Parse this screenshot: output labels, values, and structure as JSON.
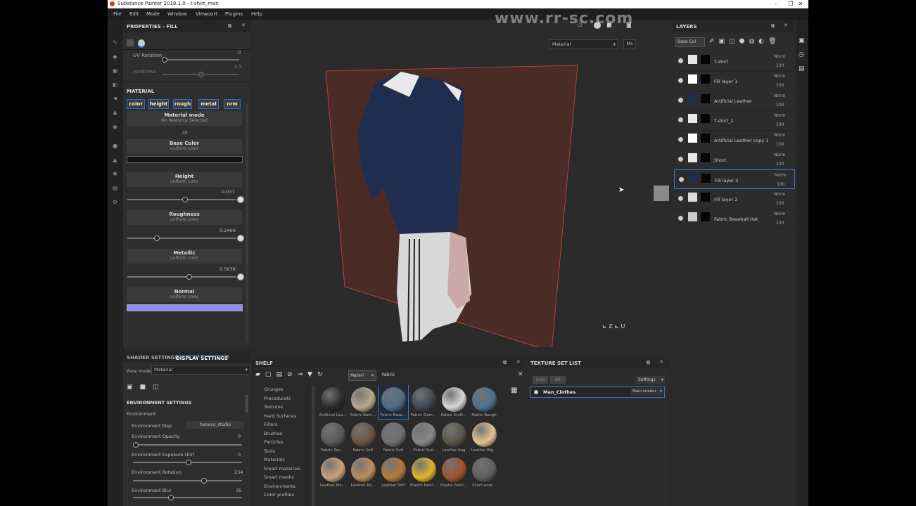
{
  "window": {
    "title": "Substance Painter 2018.1.0 - t-shirt_man",
    "controls": [
      "–",
      "❐",
      "✕"
    ]
  },
  "watermark": "www.rr-sc.com",
  "menu": [
    "File",
    "Edit",
    "Mode",
    "Window",
    "Viewport",
    "Plugins",
    "Help"
  ],
  "properties": {
    "header": "PROPERTIES - FILL",
    "uv_rotation_label": "UV Rotation",
    "uv_rotation_value": "0",
    "hardness_label": "Hardness",
    "hardness_value": "0.5",
    "material_section": "MATERIAL",
    "channels": [
      "color",
      "height",
      "rough",
      "metal",
      "nrm"
    ],
    "material_mode_title": "Material mode",
    "material_mode_sub": "No Resource Selected",
    "or_label": "Or",
    "base_color_title": "Base Color",
    "uniform_color": "uniform color",
    "height_title": "Height",
    "height_value": "0.037",
    "height_level": 0.52,
    "roughness_title": "Roughness",
    "roughness_value": "0.2469",
    "roughness_level": 0.25,
    "metallic_title": "Metallic",
    "metallic_value": "0.5638",
    "metallic_level": 0.56,
    "normal_title": "Normal",
    "normal_color": "#8f8cf4"
  },
  "viewport": {
    "material_dropdown": "Material",
    "mat_button": "Ma",
    "plane_color": "#4a2b26",
    "shirt_color": "#1f2d4f"
  },
  "layers": {
    "header": "LAYERS",
    "blend_select": "Base Col",
    "items": [
      {
        "name": "T-shirt",
        "blend": "Norm",
        "opacity": "100"
      },
      {
        "name": "Fill layer 1",
        "blend": "Norm",
        "opacity": "100"
      },
      {
        "name": "Artificial Leather",
        "blend": "Norm",
        "opacity": "100"
      },
      {
        "name": "T-shirt_2",
        "blend": "Norm",
        "opacity": "100"
      },
      {
        "name": "Artificial Leather copy 1",
        "blend": "Norm",
        "opacity": "100"
      },
      {
        "name": "Short",
        "blend": "Norm",
        "opacity": "100"
      },
      {
        "name": "Fill layer 3",
        "blend": "Norm",
        "opacity": "100"
      },
      {
        "name": "Fill layer 2",
        "blend": "Norm",
        "opacity": "100"
      },
      {
        "name": "Fabric Baseball Hat",
        "blend": "Norm",
        "opacity": "100"
      }
    ],
    "selected_index": 6
  },
  "shader": {
    "tab_shader": "SHADER SETTINGS",
    "tab_display": "DISPLAY SETTINGS",
    "view_mode_label": "View mode",
    "view_mode_value": "Material",
    "env_section": "ENVIRONMENT SETTINGS",
    "environment_label": "Environment",
    "env_map_label": "Environment Map",
    "env_map_value": "tomoco_studio",
    "env_opacity_label": "Environment Opacity",
    "env_opacity_value": "0",
    "env_exposure_label": "Environment Exposure (EV)",
    "env_exposure_value": "0",
    "env_rotation_label": "Environment Rotation",
    "env_rotation_value": "234",
    "env_blur_label": "Environment Blur",
    "env_blur_value": "35"
  },
  "shelf": {
    "header": "SHELF",
    "filter_tag": "Materi",
    "search_value": "fabric",
    "categories": [
      "Grunges",
      "Procedurals",
      "Textures",
      "Hard Surfaces",
      "Filters",
      "Brushes",
      "Particles",
      "Tools",
      "Materials",
      "Smart materials",
      "Smart masks",
      "Environments",
      "Color profiles"
    ],
    "items": [
      {
        "name": "Artificial Lea...",
        "color": "#2a2a2a"
      },
      {
        "name": "Fabric Bam...",
        "color": "#b7a98a"
      },
      {
        "name": "Fabric Base...",
        "color": "#4f6c82"
      },
      {
        "name": "Fabric Deni...",
        "color": "#3e4750"
      },
      {
        "name": "Fabric Knitt...",
        "color": "#d6d6d6"
      },
      {
        "name": "Fabric Rough",
        "color": "#4c7090"
      },
      {
        "name": "Fabric Rou...",
        "color": "#5a5a5a"
      },
      {
        "name": "Fabric Soft",
        "color": "#6a5443"
      },
      {
        "name": "Fabric Suit",
        "color": "#6f6f6f"
      },
      {
        "name": "Fabric Suit",
        "color": "#868686"
      },
      {
        "name": "Leather bag",
        "color": "#5a5548"
      },
      {
        "name": "Leather Big...",
        "color": "#e2c48e"
      },
      {
        "name": "Leather Me...",
        "color": "#c9a27a"
      },
      {
        "name": "Leather Ro...",
        "color": "#bb8e5c"
      },
      {
        "name": "Leather Soft",
        "color": "#b07b3a"
      },
      {
        "name": "Plastic Fabri...",
        "color": "#e0b42a"
      },
      {
        "name": "Plastic Fabri...",
        "color": "#a0522d"
      },
      {
        "name": "Scarf wool...",
        "color": "#5e5e5e"
      }
    ]
  },
  "texture_set_list": {
    "header": "TEXTURE SET LIST",
    "btn_a": "Solo",
    "btn_b": "All",
    "settings": "Settings",
    "set_name": "Man_Clothes",
    "shader": "Main shader"
  },
  "colors": {
    "accent": "#3b78c3",
    "panel": "#2e2e2e",
    "bg": "#2a2a2a"
  }
}
